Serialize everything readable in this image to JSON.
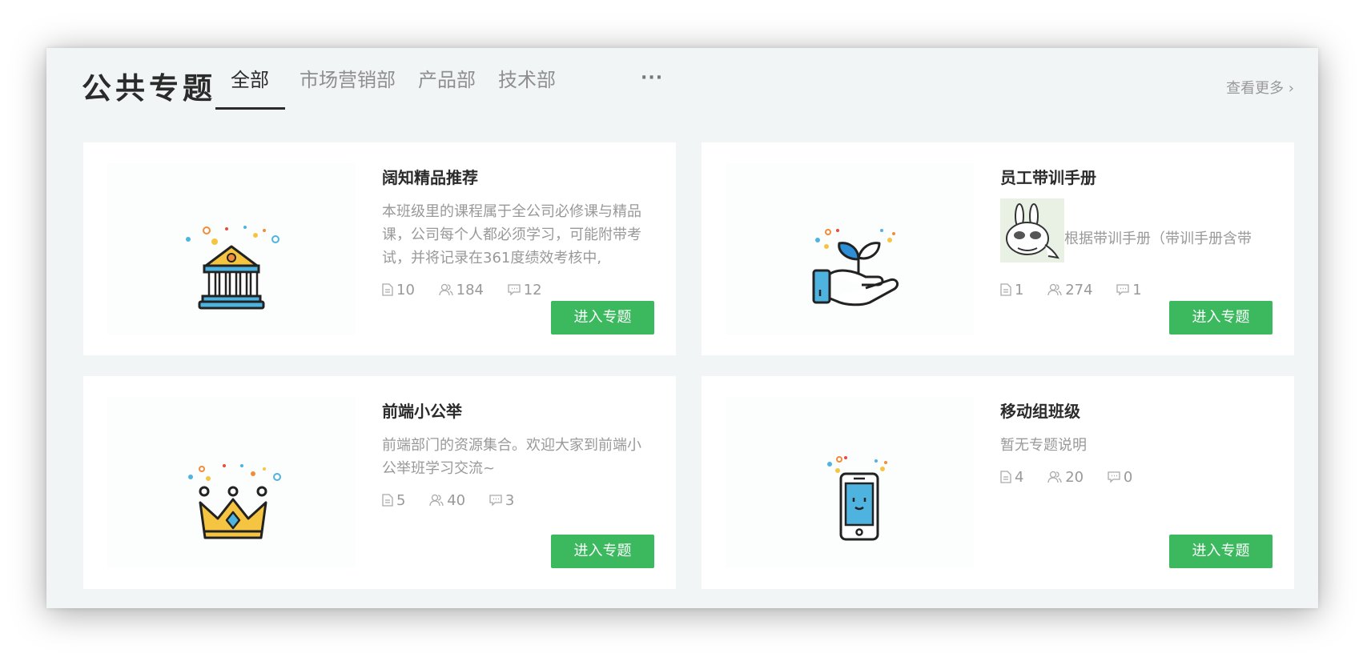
{
  "header": {
    "title": "公共专题",
    "tabs": [
      {
        "label": "全部",
        "active": true
      },
      {
        "label": "市场营销部",
        "active": false
      },
      {
        "label": "产品部",
        "active": false
      },
      {
        "label": "技术部",
        "active": false
      }
    ],
    "more_tabs": "···",
    "view_more": "查看更多 ›"
  },
  "cards": [
    {
      "title": "阔知精品推荐",
      "desc": "本班级里的课程属于全公司必修课与精品课，公司每个人都必须学习，可能附带考试，并将记录在361度绩效考核中,",
      "icon": "bank-building-icon",
      "stats": {
        "courses": "10",
        "members": "184",
        "comments": "12"
      },
      "button": "进入专题"
    },
    {
      "title": "员工带训手册",
      "desc": "根据带训手册（带训手册含带",
      "icon": "hand-plant-icon",
      "stats": {
        "courses": "1",
        "members": "274",
        "comments": "1"
      },
      "button": "进入专题"
    },
    {
      "title": "前端小公举",
      "desc": "前端部门的资源集合。欢迎大家到前端小公举班学习交流~",
      "icon": "crown-icon",
      "stats": {
        "courses": "5",
        "members": "40",
        "comments": "3"
      },
      "button": "进入专题"
    },
    {
      "title": "移动组班级",
      "desc": "暂无专题说明",
      "icon": "phone-icon",
      "stats": {
        "courses": "4",
        "members": "20",
        "comments": "0"
      },
      "button": "进入专题"
    }
  ],
  "colors": {
    "accent": "#3cb95f",
    "background": "#f2f5f6",
    "card": "#ffffff"
  }
}
